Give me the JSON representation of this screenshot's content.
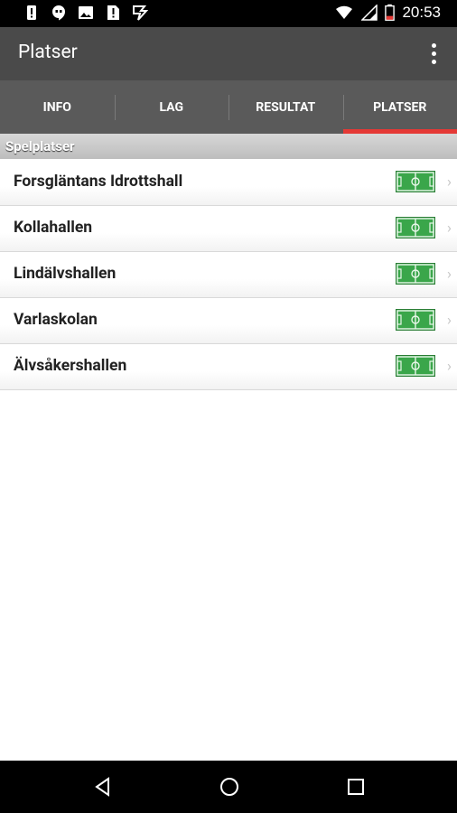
{
  "status_bar": {
    "time": "20:53",
    "left_icons": [
      "alert-icon",
      "hangouts-icon",
      "image-icon",
      "sim-alert-icon",
      "play-store-icon"
    ],
    "right_icons": [
      "wifi-icon",
      "signal-icon",
      "battery-low-icon"
    ]
  },
  "app_bar": {
    "title": "Platser",
    "menu_icon": "overflow-menu-icon"
  },
  "tabs": [
    {
      "label": "INFO",
      "active": false
    },
    {
      "label": "LAG",
      "active": false
    },
    {
      "label": "RESULTAT",
      "active": false
    },
    {
      "label": "PLATSER",
      "active": true
    }
  ],
  "section": {
    "title": "Spelplatser"
  },
  "venues": [
    {
      "name": "Forsgläntans Idrottshall",
      "icon": "field-icon"
    },
    {
      "name": "Kollahallen",
      "icon": "field-icon"
    },
    {
      "name": "Lindälvshallen",
      "icon": "field-icon"
    },
    {
      "name": "Varlaskolan",
      "icon": "field-icon"
    },
    {
      "name": "Älvsåkershallen",
      "icon": "field-icon"
    }
  ],
  "nav_bar": {
    "buttons": [
      "back-icon",
      "home-icon",
      "recents-icon"
    ]
  },
  "colors": {
    "accent": "#e53935",
    "app_bar": "#4a4a4a",
    "tabs": "#5a5a5a",
    "field_green": "#3aa64a"
  }
}
